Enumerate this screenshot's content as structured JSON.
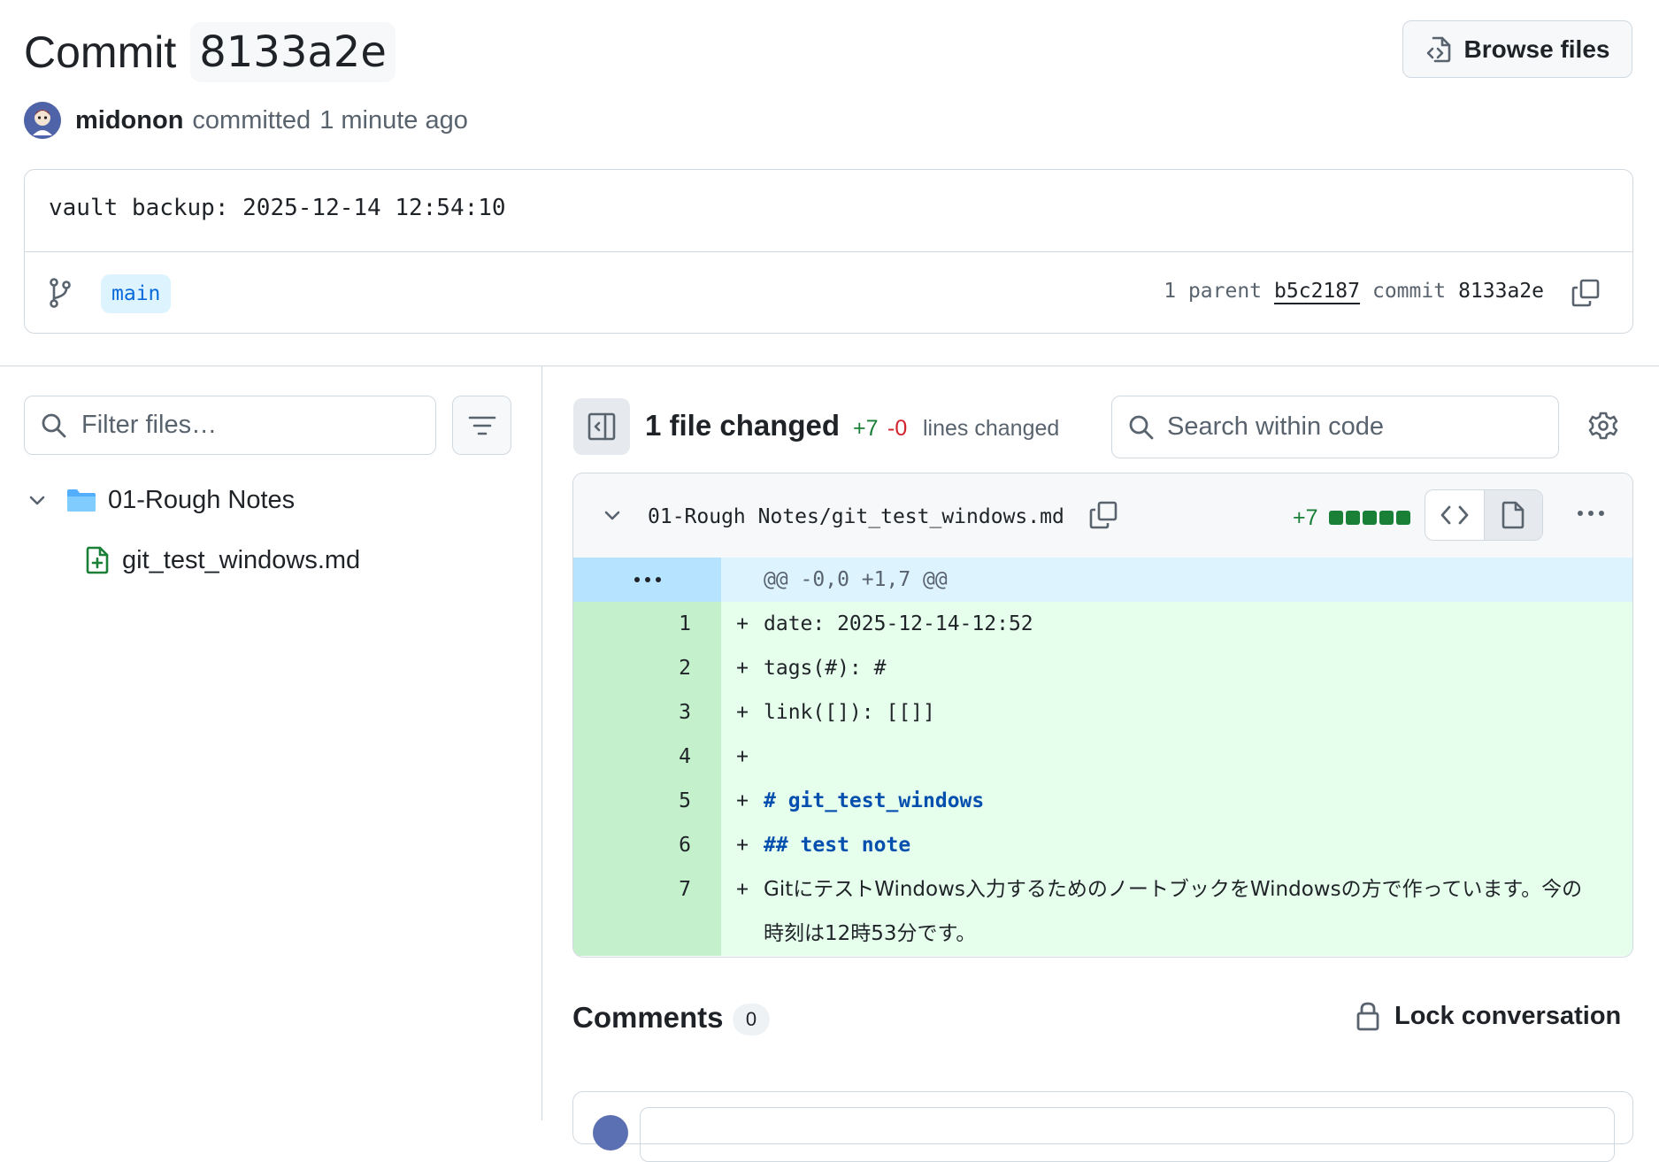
{
  "commit": {
    "word": "Commit",
    "sha": "8133a2e",
    "browse_files": "Browse files"
  },
  "author": {
    "name": "midonon",
    "action": "committed",
    "time": "1 minute ago"
  },
  "message": {
    "text": "vault backup: 2025-12-14 12:54:10",
    "branch": "main",
    "parent_count_label": "1 parent",
    "parent_sha": "b5c2187",
    "commit_label": "commit",
    "commit_sha": "8133a2e"
  },
  "tree": {
    "filter_placeholder": "Filter files…",
    "folder": "01-Rough Notes",
    "file": "git_test_windows.md"
  },
  "toolbar": {
    "files_changed": "1 file changed",
    "additions": "+7",
    "deletions": "-0",
    "lines_changed": "lines changed",
    "search_placeholder": "Search within code"
  },
  "diff": {
    "path": "01-Rough Notes/git_test_windows.md",
    "additions": "+7",
    "additions_blocks": 5,
    "hunk": "@@ -0,0 +1,7 @@",
    "lines": [
      {
        "num": "1",
        "sign": "+",
        "text": "date: 2025-12-14-12:52",
        "style": "plain"
      },
      {
        "num": "2",
        "sign": "+",
        "text": "tags(#): #",
        "style": "plain"
      },
      {
        "num": "3",
        "sign": "+",
        "text": "link([]): [[]]",
        "style": "plain"
      },
      {
        "num": "4",
        "sign": "+",
        "text": "",
        "style": "plain"
      },
      {
        "num": "5",
        "sign": "+",
        "text": "# git_test_windows",
        "style": "head"
      },
      {
        "num": "6",
        "sign": "+",
        "text": "## test note",
        "style": "head"
      },
      {
        "num": "7",
        "sign": "+",
        "text": "GitにテストWindows入力するためのノートブックをWindowsの方で作っています。今の時刻は12時53分です。",
        "style": "jp"
      }
    ]
  },
  "comments": {
    "title": "Comments",
    "count": "0",
    "lock": "Lock conversation"
  },
  "colors": {
    "accent": "#0969da",
    "addition": "#1a7f37",
    "deletion": "#d1242f",
    "hunk_bg": "#ddf4ff",
    "added_bg": "#e6ffec"
  }
}
